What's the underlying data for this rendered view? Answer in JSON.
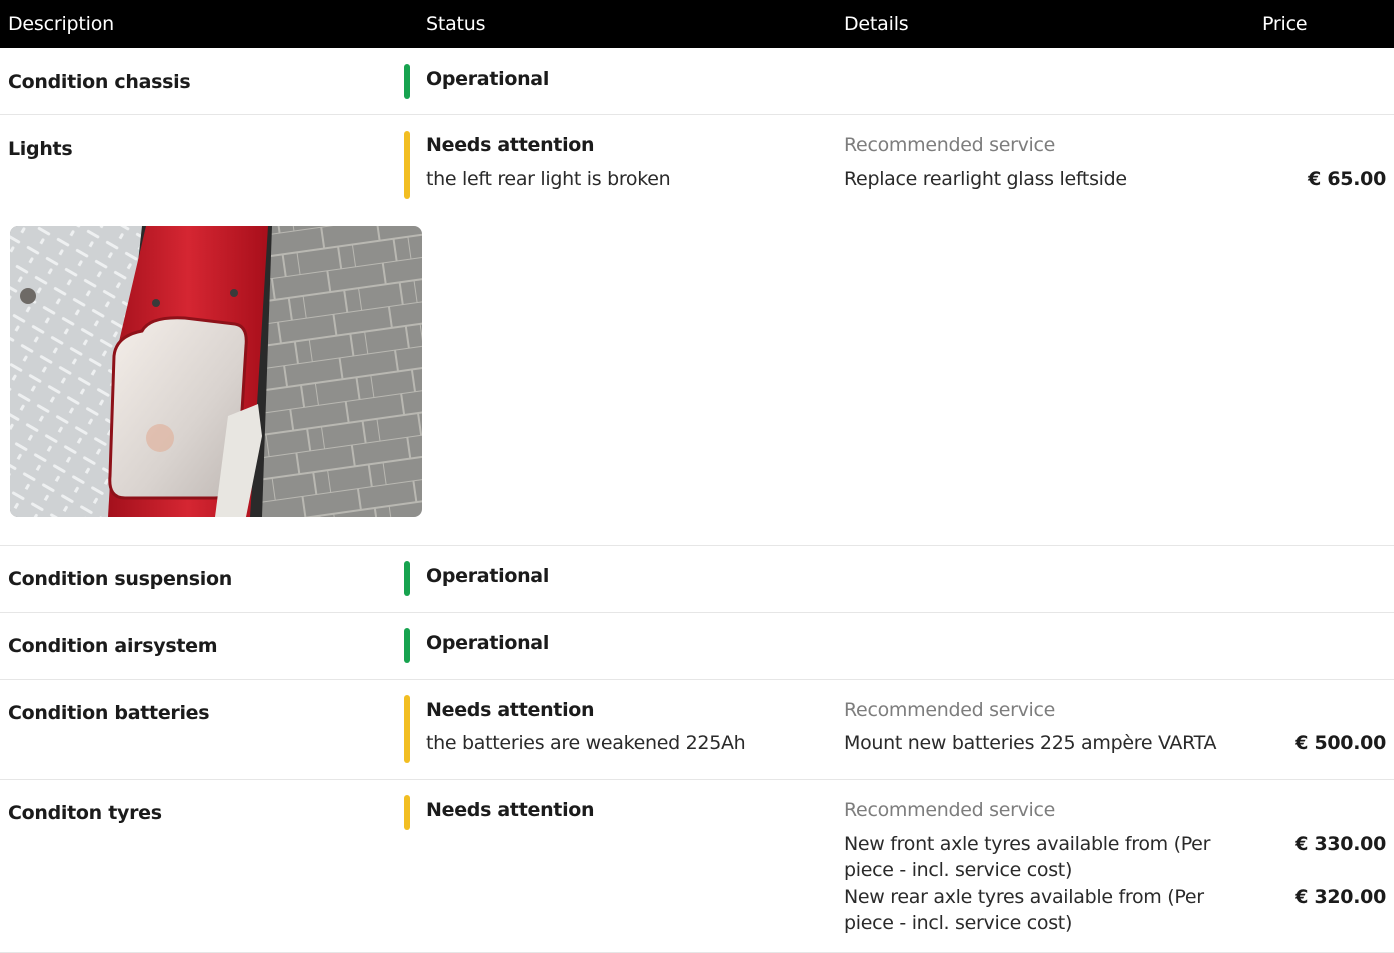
{
  "columns": {
    "description": "Description",
    "status": "Status",
    "details": "Details",
    "price": "Price"
  },
  "colors": {
    "operational": "#17a34f",
    "attention": "#f2be22"
  },
  "rows": [
    {
      "description": "Condition chassis",
      "status": "Operational"
    },
    {
      "description": "Lights",
      "status": "Needs attention",
      "note": "the left rear light is broken",
      "recommended_label": "Recommended service",
      "services": [
        {
          "text": "Replace rearlight glass leftside",
          "price": "€ 65.00"
        }
      ]
    },
    {
      "description": "Condition suspension",
      "status": "Operational"
    },
    {
      "description": "Condition airsystem",
      "status": "Operational"
    },
    {
      "description": "Condition batteries",
      "status": "Needs attention",
      "note": "the batteries are weakened 225Ah",
      "recommended_label": "Recommended service",
      "services": [
        {
          "text": "Mount new batteries 225 ampère VARTA",
          "price": "€ 500.00"
        }
      ]
    },
    {
      "description": "Conditon tyres",
      "status": "Needs attention",
      "recommended_label": "Recommended service",
      "services": [
        {
          "text": "New front axle tyres available from (Per piece - incl. service cost)",
          "price": "€ 330.00"
        },
        {
          "text": "New rear axle tyres available from (Per piece - incl. service cost)",
          "price": "€ 320.00"
        }
      ]
    }
  ]
}
